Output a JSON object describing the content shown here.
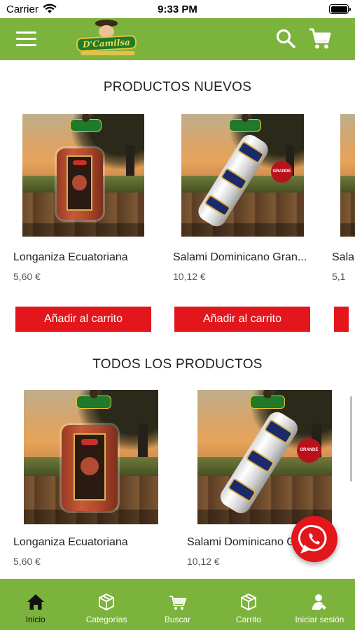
{
  "status_bar": {
    "carrier": "Carrier",
    "time": "9:33 PM"
  },
  "header": {
    "logo_text": "D'Camilsa"
  },
  "sections": {
    "new_products": {
      "title": "PRODUCTOS NUEVOS",
      "products": [
        {
          "name": "Longaniza Ecuatoriana",
          "price": "5,60 €",
          "button": "Añadir al carrito"
        },
        {
          "name": "Salami Dominicano Gran...",
          "price": "10,12 €",
          "button": "Añadir al carrito",
          "badge": "GRANDE"
        },
        {
          "name": "Sala",
          "price": "5,1",
          "button": ""
        }
      ]
    },
    "all_products": {
      "title": "TODOS LOS PRODUCTOS",
      "products": [
        {
          "name": "Longaniza Ecuatoriana",
          "price": "5,60 €"
        },
        {
          "name": "Salami Dominicano G",
          "price": "10,12 €",
          "badge": "GRANDE"
        }
      ]
    }
  },
  "bottom_nav": [
    {
      "label": "Inicio",
      "icon": "home-icon",
      "active": true
    },
    {
      "label": "Categorías",
      "icon": "box-icon",
      "active": false
    },
    {
      "label": "Buscar",
      "icon": "cart-search-icon",
      "active": false
    },
    {
      "label": "Carrito",
      "icon": "box-icon",
      "active": false
    },
    {
      "label": "Iniciar sesión",
      "icon": "user-icon",
      "active": false
    }
  ],
  "colors": {
    "brand_green": "#7cb33c",
    "accent_red": "#e3161c"
  }
}
